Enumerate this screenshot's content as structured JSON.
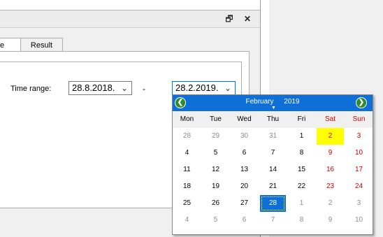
{
  "window": {
    "restore_glyph": "🗗",
    "close_glyph": "✕"
  },
  "tabs": [
    {
      "label": "e"
    },
    {
      "label": "Result"
    }
  ],
  "form": {
    "time_range_label": "Time range:",
    "date_from": "28.8.2018.",
    "date_to": "28.2.2019.",
    "separator": "-"
  },
  "calendar": {
    "month": "February",
    "year": "2019",
    "weekdays": [
      "Mon",
      "Tue",
      "Wed",
      "Thu",
      "Fri",
      "Sat",
      "Sun"
    ],
    "weeks": [
      [
        [
          "28",
          "grey"
        ],
        [
          "29",
          "grey"
        ],
        [
          "30",
          "grey"
        ],
        [
          "31",
          "grey"
        ],
        [
          "1",
          ""
        ],
        [
          "2",
          "red today"
        ],
        [
          "3",
          "red"
        ]
      ],
      [
        [
          "4",
          ""
        ],
        [
          "5",
          ""
        ],
        [
          "6",
          ""
        ],
        [
          "7",
          ""
        ],
        [
          "8",
          ""
        ],
        [
          "9",
          "red"
        ],
        [
          "10",
          "red"
        ]
      ],
      [
        [
          "11",
          ""
        ],
        [
          "12",
          ""
        ],
        [
          "13",
          ""
        ],
        [
          "14",
          ""
        ],
        [
          "15",
          ""
        ],
        [
          "16",
          "red"
        ],
        [
          "17",
          "red"
        ]
      ],
      [
        [
          "18",
          ""
        ],
        [
          "19",
          ""
        ],
        [
          "20",
          ""
        ],
        [
          "21",
          ""
        ],
        [
          "22",
          ""
        ],
        [
          "23",
          "red"
        ],
        [
          "24",
          "red"
        ]
      ],
      [
        [
          "25",
          ""
        ],
        [
          "26",
          ""
        ],
        [
          "27",
          ""
        ],
        [
          "28",
          "selected"
        ],
        [
          "1",
          "grey"
        ],
        [
          "2",
          "grey"
        ],
        [
          "3",
          "grey"
        ]
      ],
      [
        [
          "4",
          "grey"
        ],
        [
          "5",
          "grey"
        ],
        [
          "6",
          "grey"
        ],
        [
          "7",
          "grey"
        ],
        [
          "8",
          "grey"
        ],
        [
          "9",
          "grey"
        ],
        [
          "10",
          "grey"
        ]
      ]
    ],
    "colors": {
      "header": "#0e6fd6",
      "today": "#ffff00",
      "weekend": "#cc0000"
    }
  }
}
